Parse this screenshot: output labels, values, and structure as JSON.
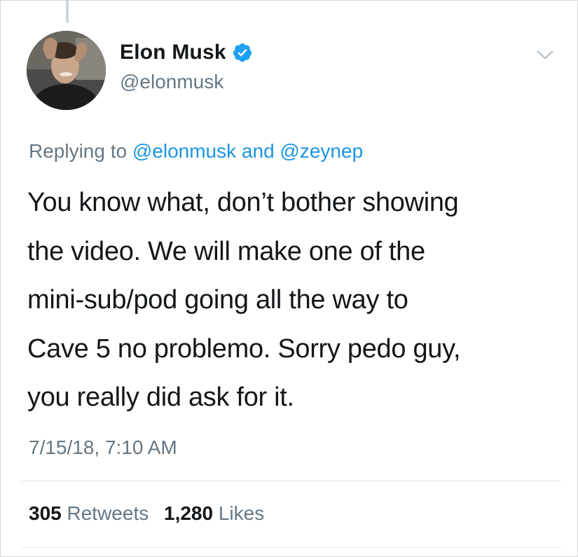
{
  "tweet": {
    "author": {
      "name": "Elon Musk",
      "handle": "@elonmusk",
      "verified": true
    },
    "reply_context": {
      "prefix": "Replying to",
      "mentions": [
        "@elonmusk",
        "@zeynep"
      ],
      "joiner": "and"
    },
    "text_lines": [
      "You know what, don’t bother showing",
      "the video. We will make one of the",
      "mini-sub/pod going all the way to",
      "Cave 5 no problemo. Sorry pedo guy,",
      "you really did ask for it."
    ],
    "timestamp": "7/15/18, 7:10 AM",
    "stats": {
      "retweets_count": "305",
      "retweets_label": "Retweets",
      "likes_count": "1,280",
      "likes_label": "Likes"
    }
  },
  "icons": {
    "verified": "verified-badge-icon",
    "menu": "chevron-down-icon"
  },
  "colors": {
    "link": "#1b95e0",
    "secondary_text": "#657786",
    "primary_text": "#14171a",
    "verified_badge": "#1da1f2"
  }
}
